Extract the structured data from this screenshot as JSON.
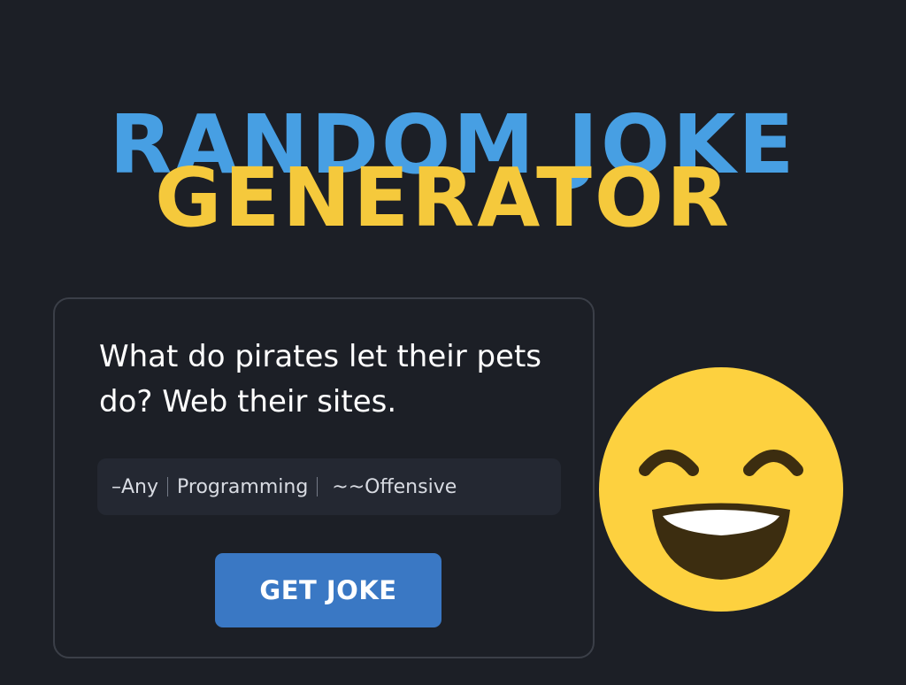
{
  "header": {
    "title_line1": "RANDOM JOKE",
    "title_line2": "GENERATOR"
  },
  "joke": {
    "text": "What do pirates let their pets do? Web their sites."
  },
  "categories": {
    "items": [
      "–Any",
      "Programming",
      "~~Offensive"
    ]
  },
  "button": {
    "label": "GET JOKE"
  },
  "decor": {
    "icon": "grinning-face-with-smiling-eyes-icon"
  },
  "colors": {
    "background": "#1c1f26",
    "title_blue": "#479fe3",
    "title_yellow": "#f5c93c",
    "button_blue": "#3a78c4",
    "emoji_yellow": "#fdd13f",
    "emoji_features": "#3c2d10"
  }
}
